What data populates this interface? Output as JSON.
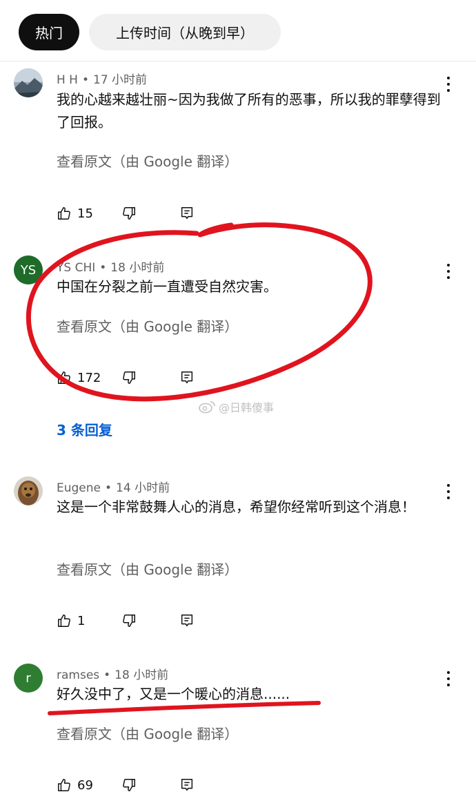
{
  "tabs": [
    {
      "label": "热门",
      "active": true
    },
    {
      "label": "上传时间（从晚到早）",
      "active": false
    }
  ],
  "comments": [
    {
      "author": "H H",
      "time": "17 小时前",
      "text": "我的心越来越壮丽~因为我做了所有的恶事，所以我的罪孽得到了回报。",
      "translate_label": "查看原文（由 Google 翻译）",
      "likes": "15",
      "avatar_letters": ""
    },
    {
      "author": "YS CHI",
      "time": "18 小时前",
      "text": "中国在分裂之前一直遭受自然灾害。",
      "translate_label": "查看原文（由 Google 翻译）",
      "likes": "172",
      "avatar_letters": "YS",
      "replies_label": "3 条回复"
    },
    {
      "author": "Eugene",
      "time": "14 小时前",
      "text": "这是一个非常鼓舞人心的消息，希望你经常听到这个消息！",
      "translate_label": "查看原文（由 Google 翻译）",
      "likes": "1",
      "avatar_letters": ""
    },
    {
      "author": "ramses",
      "time": "18 小时前",
      "text": "好久没中了，又是一个暖心的消息......",
      "translate_label": "查看原文（由 Google 翻译）",
      "likes": "69",
      "avatar_letters": "r"
    }
  ],
  "watermark": "@日韩傻事",
  "meta_separator": "•",
  "icons": {
    "like": "thumb-up-icon",
    "dislike": "thumb-down-icon",
    "reply": "reply-comment-icon",
    "more": "more-vertical-icon"
  },
  "colors": {
    "avatar_ys": "#1e6b2a",
    "avatar_r": "#2e7d32",
    "link_blue": "#065fd4",
    "annotation_red": "#e0141e"
  }
}
